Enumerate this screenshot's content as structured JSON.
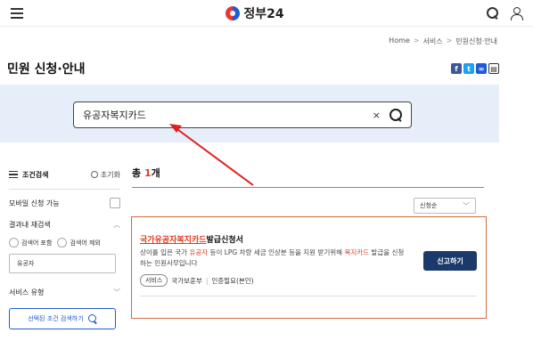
{
  "header": {
    "logo_text": "정부24"
  },
  "breadcrumb": [
    "Home",
    "서비스",
    "민원신청·안내"
  ],
  "page_title": "민원 신청·안내",
  "search": {
    "value": "유공자복지카드",
    "clear_label": "×"
  },
  "filter": {
    "title": "조건검색",
    "reset_label": "초기화",
    "mobile_label": "모바일 신청 가능",
    "within_title": "결과내 재검색",
    "within_options": [
      "검색어 포함",
      "검색어 제외"
    ],
    "within_value": "유공자",
    "service_type_label": "서비스 유형",
    "apply_label": "선택된 조건 검색하기"
  },
  "results": {
    "total_prefix": "총 ",
    "total_count": "1",
    "total_suffix": "개",
    "sort_value": "신청순",
    "item": {
      "title_highlight": "국가유공자복지카드",
      "title_rest": "발급신청서",
      "desc_part1": "상이를 입은 국가 ",
      "desc_hl1": "유공자",
      "desc_part2": " 등이 LPG 차량 세금 인상분 등을 지원 받기위해 ",
      "desc_hl2": "복지카드",
      "desc_part3": " 발급을 신청하는 민원사무입니다",
      "tag": "서비스",
      "agency": "국가보훈부",
      "auth": "인증필요(본인)",
      "button_label": "신고하기"
    }
  },
  "colors": {
    "highlight": "#e03a1e",
    "search_band": "#e6eef9",
    "card_border": "#d7673f",
    "primary_button": "#1a3a6b",
    "arrow": "#e02020"
  }
}
